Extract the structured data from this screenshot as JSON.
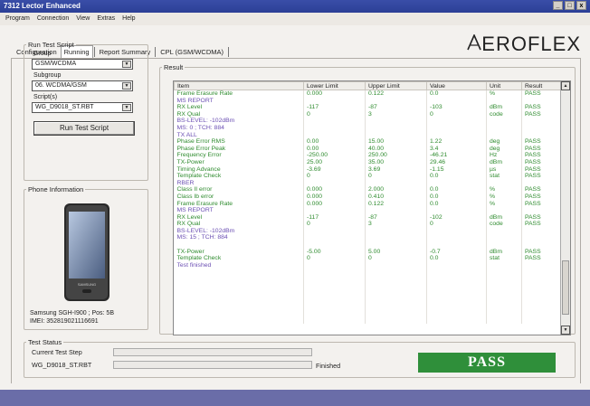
{
  "window": {
    "title": "7312 Lector Enhanced",
    "controls": [
      "_",
      "□",
      "x"
    ]
  },
  "menu": [
    "Program",
    "Connection",
    "View",
    "Extras",
    "Help"
  ],
  "logo": {
    "text": "EROFLEX"
  },
  "tabs": [
    {
      "label": "Configuration",
      "active": false
    },
    {
      "label": "Running",
      "active": true
    },
    {
      "label": "Report Summary",
      "active": false
    },
    {
      "label": "CPL (GSM/WCDMA)",
      "active": false
    }
  ],
  "run_script": {
    "legend": "Run Test Script",
    "group_label": "Group",
    "group_value": "GSM/WCDMA",
    "subgroup_label": "Subgroup",
    "subgroup_value": "06. WCDMA/GSM",
    "scripts_label": "Script(s)",
    "scripts_value": "WG_D9018_ST.RBT",
    "button": "Run Test Script"
  },
  "phone_info": {
    "legend": "Phone Information",
    "model_line": "Samsung SGH-I900  ;  Pos: 5B",
    "imei_line": "IMEI: 352819021116691",
    "screen_brand": "SAMSUNG"
  },
  "result": {
    "legend": "Result",
    "columns": [
      "Item",
      "Lower Limit",
      "Upper Limit",
      "Value",
      "Unit",
      "Result"
    ],
    "rows": [
      {
        "kind": "val",
        "cells": [
          "Frame Erasure Rate",
          "0.000",
          "0.122",
          "0.0",
          "%",
          "PASS"
        ]
      },
      {
        "kind": "hdr",
        "cells": [
          "MS REPORT",
          "",
          "",
          "",
          "",
          ""
        ]
      },
      {
        "kind": "val",
        "cells": [
          "RX Level",
          "-117",
          "-87",
          "-103",
          "dBm",
          "PASS"
        ]
      },
      {
        "kind": "val",
        "cells": [
          "RX Qual",
          "0",
          "3",
          "0",
          "code",
          "PASS"
        ]
      },
      {
        "kind": "hdr",
        "cells": [
          "BS-LEVEL: -102dBm",
          "",
          "",
          "",
          "",
          ""
        ]
      },
      {
        "kind": "hdr",
        "cells": [
          "MS: 0 ; TCH: 884",
          "",
          "",
          "",
          "",
          ""
        ]
      },
      {
        "kind": "hdr",
        "cells": [
          "TX ALL",
          "",
          "",
          "",
          "",
          ""
        ]
      },
      {
        "kind": "val",
        "cells": [
          "Phase Error RMS",
          "0.00",
          "15.00",
          "1.22",
          "deg",
          "PASS"
        ]
      },
      {
        "kind": "val",
        "cells": [
          "Phase Error Peak",
          "0.00",
          "40.00",
          "3.4",
          "deg",
          "PASS"
        ]
      },
      {
        "kind": "val",
        "cells": [
          "Frequency Error",
          "-250.00",
          "250.00",
          "-46.21",
          "Hz",
          "PASS"
        ]
      },
      {
        "kind": "val",
        "cells": [
          "TX-Power",
          "25.00",
          "35.00",
          "29.46",
          "dBm",
          "PASS"
        ]
      },
      {
        "kind": "val",
        "cells": [
          "Timing Advance",
          "-3.69",
          "3.69",
          "-1.15",
          "µs",
          "PASS"
        ]
      },
      {
        "kind": "val",
        "cells": [
          "Template Check",
          "0",
          "0",
          "0.0",
          "stat",
          "PASS"
        ]
      },
      {
        "kind": "hdr",
        "cells": [
          "RBER",
          "",
          "",
          "",
          "",
          ""
        ]
      },
      {
        "kind": "val",
        "cells": [
          "Class II error",
          "0.000",
          "2.000",
          "0.0",
          "%",
          "PASS"
        ]
      },
      {
        "kind": "val",
        "cells": [
          "Class Ib error",
          "0.000",
          "0.410",
          "0.0",
          "%",
          "PASS"
        ]
      },
      {
        "kind": "val",
        "cells": [
          "Frame Erasure Rate",
          "0.000",
          "0.122",
          "0.0",
          "%",
          "PASS"
        ]
      },
      {
        "kind": "hdr",
        "cells": [
          "MS REPORT",
          "",
          "",
          "",
          "",
          ""
        ]
      },
      {
        "kind": "val",
        "cells": [
          "RX Level",
          "-117",
          "-87",
          "-102",
          "dBm",
          "PASS"
        ]
      },
      {
        "kind": "val",
        "cells": [
          "RX Qual",
          "0",
          "3",
          "0",
          "code",
          "PASS"
        ]
      },
      {
        "kind": "hdr",
        "cells": [
          "BS-LEVEL: -102dBm",
          "",
          "",
          "",
          "",
          ""
        ]
      },
      {
        "kind": "hdr",
        "cells": [
          "MS: 15 ; TCH: 884",
          "",
          "",
          "",
          "",
          ""
        ]
      },
      {
        "kind": "hdr",
        "cells": [
          "",
          "",
          "",
          "",
          "",
          ""
        ]
      },
      {
        "kind": "val",
        "cells": [
          "TX-Power",
          "-5.00",
          "5.00",
          "-0.7",
          "dBm",
          "PASS"
        ]
      },
      {
        "kind": "val",
        "cells": [
          "Template Check",
          "0",
          "0",
          "0.0",
          "stat",
          "PASS"
        ]
      },
      {
        "kind": "hdr",
        "cells": [
          "Test finished",
          "",
          "",
          "",
          "",
          ""
        ]
      },
      {
        "kind": "hdr",
        "cells": [
          "",
          "",
          "",
          "",
          "",
          ""
        ]
      },
      {
        "kind": "hdr",
        "cells": [
          "",
          "",
          "",
          "",
          "",
          ""
        ]
      },
      {
        "kind": "hdr",
        "cells": [
          "",
          "",
          "",
          "",
          "",
          ""
        ]
      },
      {
        "kind": "hdr",
        "cells": [
          "",
          "",
          "",
          "",
          "",
          ""
        ]
      },
      {
        "kind": "hdr",
        "cells": [
          "",
          "",
          "",
          "",
          "",
          ""
        ]
      },
      {
        "kind": "hdr",
        "cells": [
          "",
          "",
          "",
          "",
          "",
          ""
        ]
      },
      {
        "kind": "hdr",
        "cells": [
          "",
          "",
          "",
          "",
          "",
          ""
        ]
      },
      {
        "kind": "hdr",
        "cells": [
          "",
          "",
          "",
          "",
          "",
          ""
        ]
      }
    ]
  },
  "test_status": {
    "legend": "Test Status",
    "current_step_label": "Current Test Step",
    "script_name": "WG_D9018_ST.RBT",
    "state": "Finished",
    "verdict": "PASS"
  },
  "colors": {
    "pass_banner": "#2f8f3a",
    "value_text": "#2e8b2e",
    "header_text": "#6b4fb3"
  }
}
